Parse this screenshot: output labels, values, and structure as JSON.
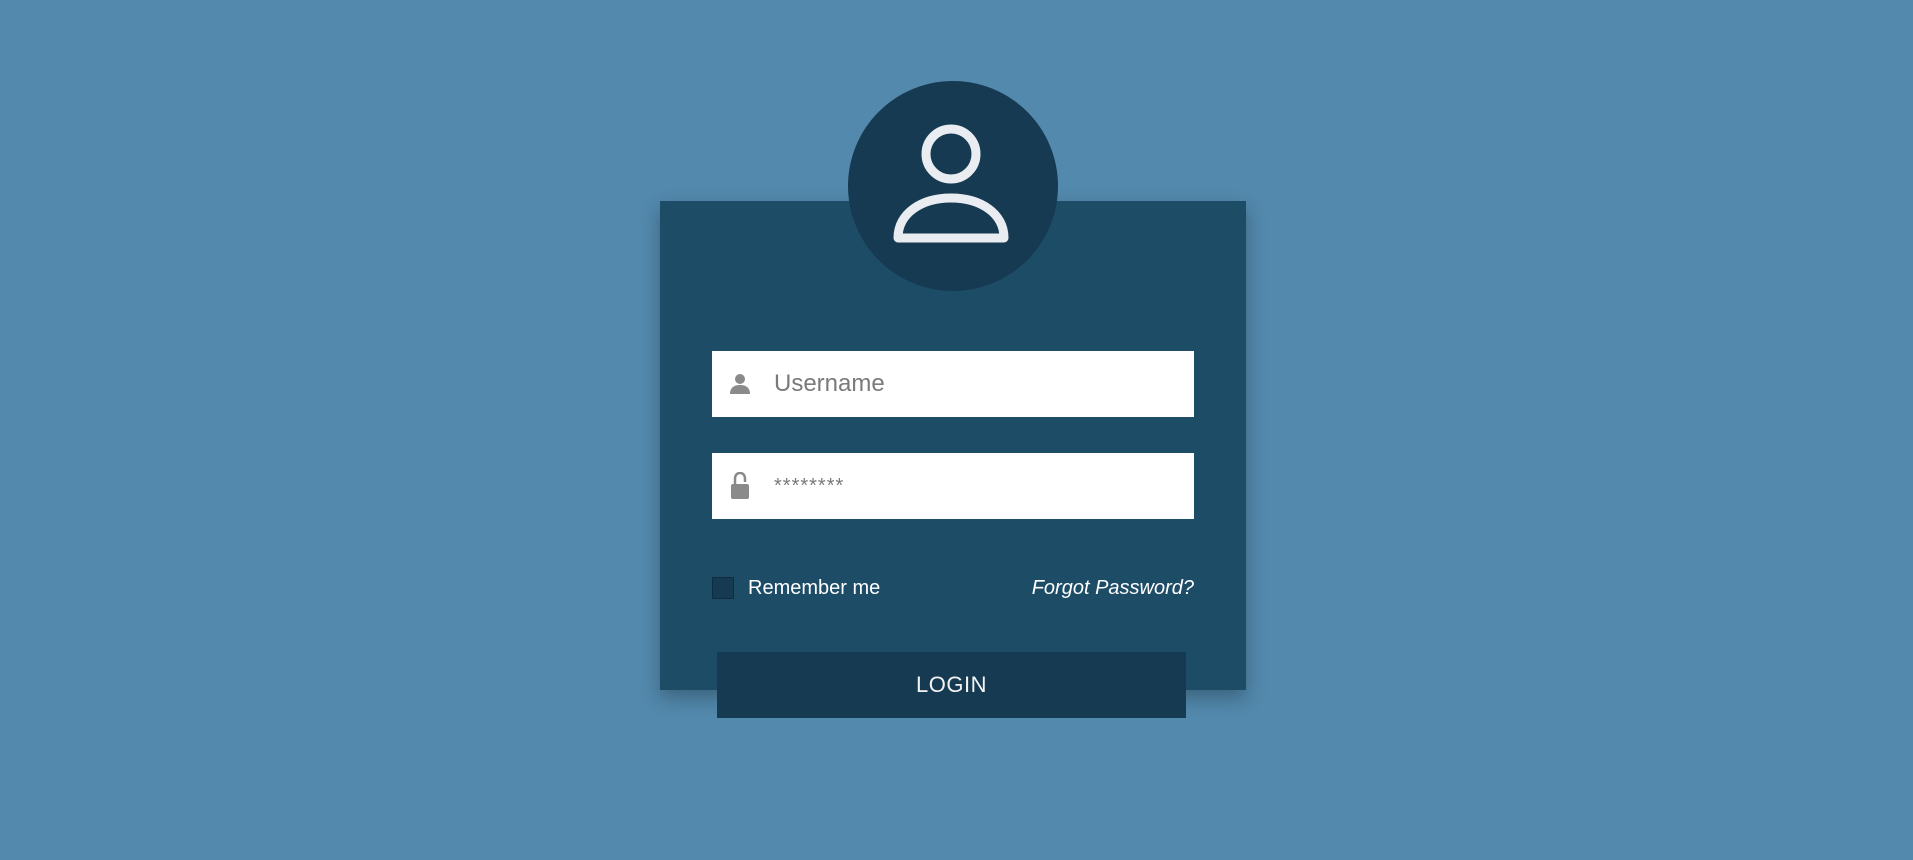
{
  "login": {
    "avatar_icon": "user-outline-icon",
    "username": {
      "icon": "person-icon",
      "placeholder": "Username",
      "value": ""
    },
    "password": {
      "icon": "lock-icon",
      "placeholder": "********",
      "value": ""
    },
    "remember_label": "Remember me",
    "remember_checked": false,
    "forgot_label": "Forgot Password?",
    "button_label": "LOGIN"
  },
  "colors": {
    "background": "#5389ad",
    "card": "#1d4c67",
    "avatar_circle": "#163a52",
    "button": "#153a52",
    "text_light": "#ffffff",
    "icon_gray": "#8a8a8a"
  }
}
